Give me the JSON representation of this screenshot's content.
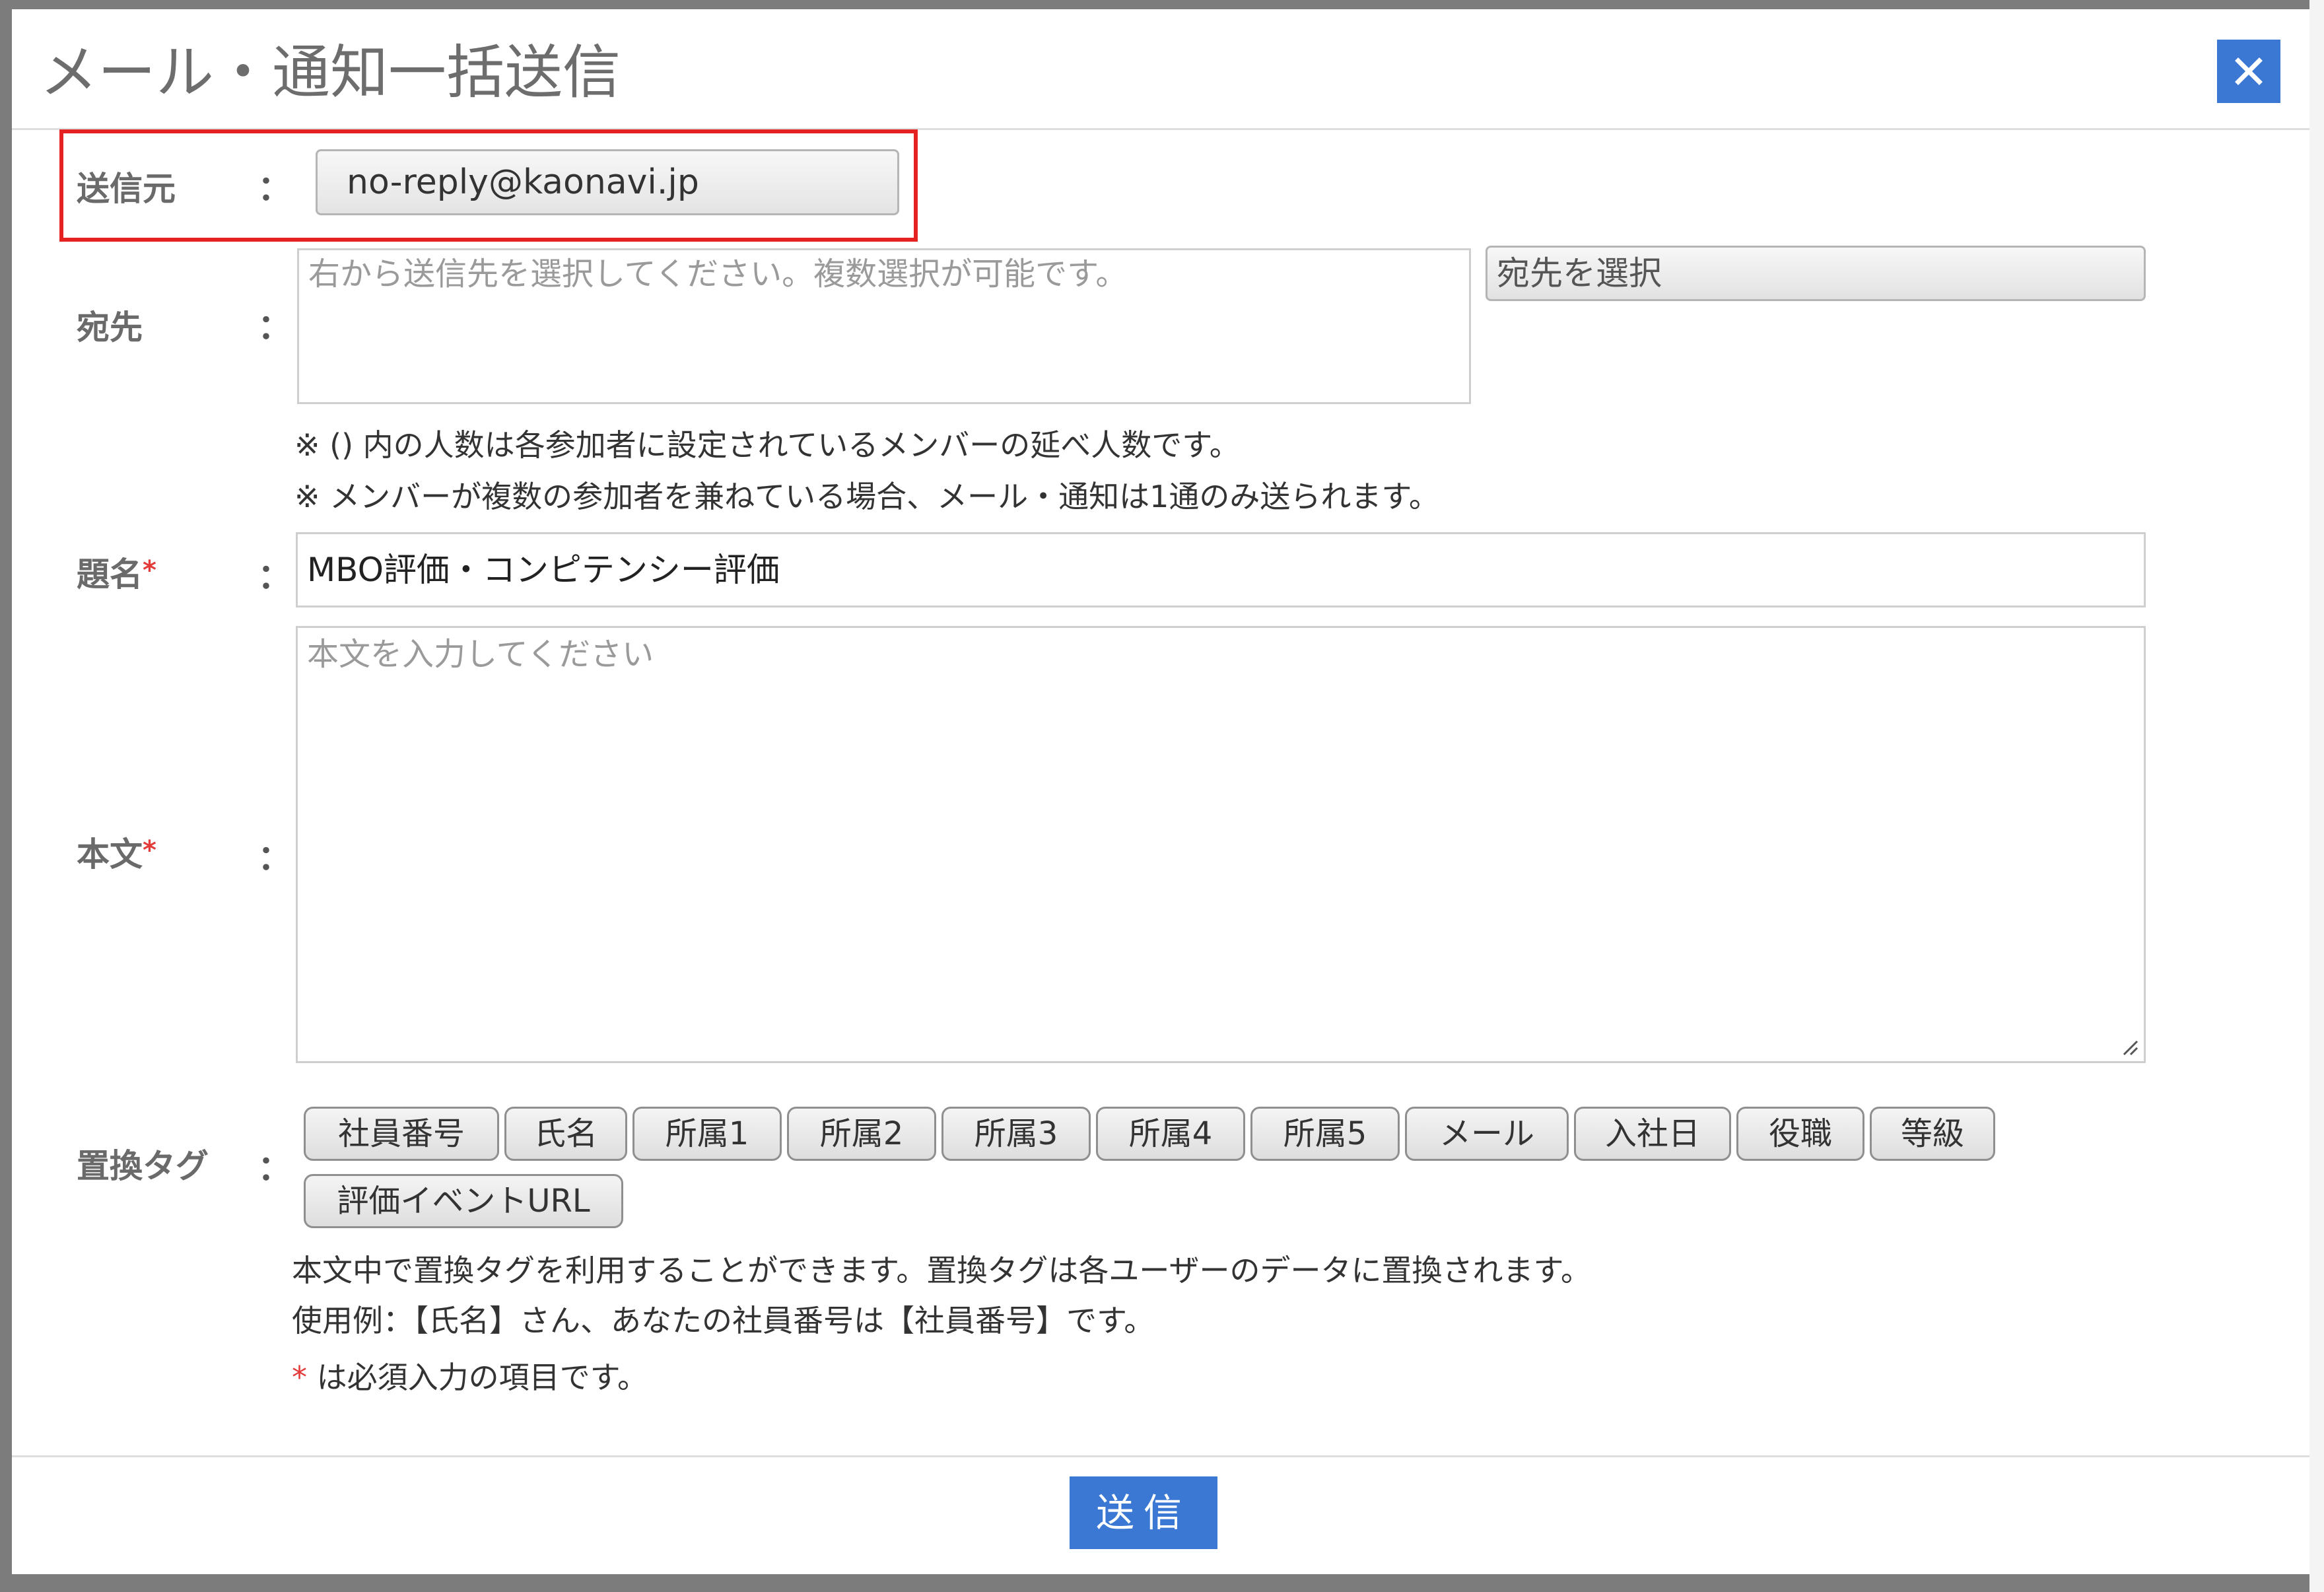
{
  "dialog": {
    "title": "メール・通知一括送信",
    "close_label": "✕"
  },
  "form": {
    "sender": {
      "label": "送信元",
      "colon": "：",
      "value": "no-reply@kaonavi.jp"
    },
    "recipients": {
      "label": "宛先",
      "colon": "：",
      "placeholder": "右から送信先を選択してください。複数選択が可能です。",
      "select_button": "宛先を選択",
      "note1": "※ () 内の人数は各参加者に設定されているメンバーの延べ人数です。",
      "note2": "※ メンバーが複数の参加者を兼ねている場合、メール・通知は1通のみ送られます。"
    },
    "subject": {
      "label": "題名",
      "required_mark": "*",
      "colon": "：",
      "value": "MBO評価・コンピテンシー評価"
    },
    "body": {
      "label": "本文",
      "required_mark": "*",
      "colon": "：",
      "placeholder": "本文を入力してください"
    },
    "tags": {
      "label": "置換タグ",
      "colon": "：",
      "items": [
        "社員番号",
        "氏名",
        "所属1",
        "所属2",
        "所属3",
        "所属4",
        "所属5",
        "メール",
        "入社日",
        "役職",
        "等級",
        "評価イベントURL"
      ],
      "help1": "本文中で置換タグを利用することができます。置換タグは各ユーザーのデータに置換されます。",
      "help2": "使用例：【氏名】さん、あなたの社員番号は【社員番号】です。",
      "required_note_mark": "*",
      "required_note_text": " は必須入力の項目です。"
    }
  },
  "footer": {
    "send_button": "送信"
  },
  "colors": {
    "accent": "#3a78d4",
    "highlight": "#e52222",
    "required": "#e43a3a"
  }
}
